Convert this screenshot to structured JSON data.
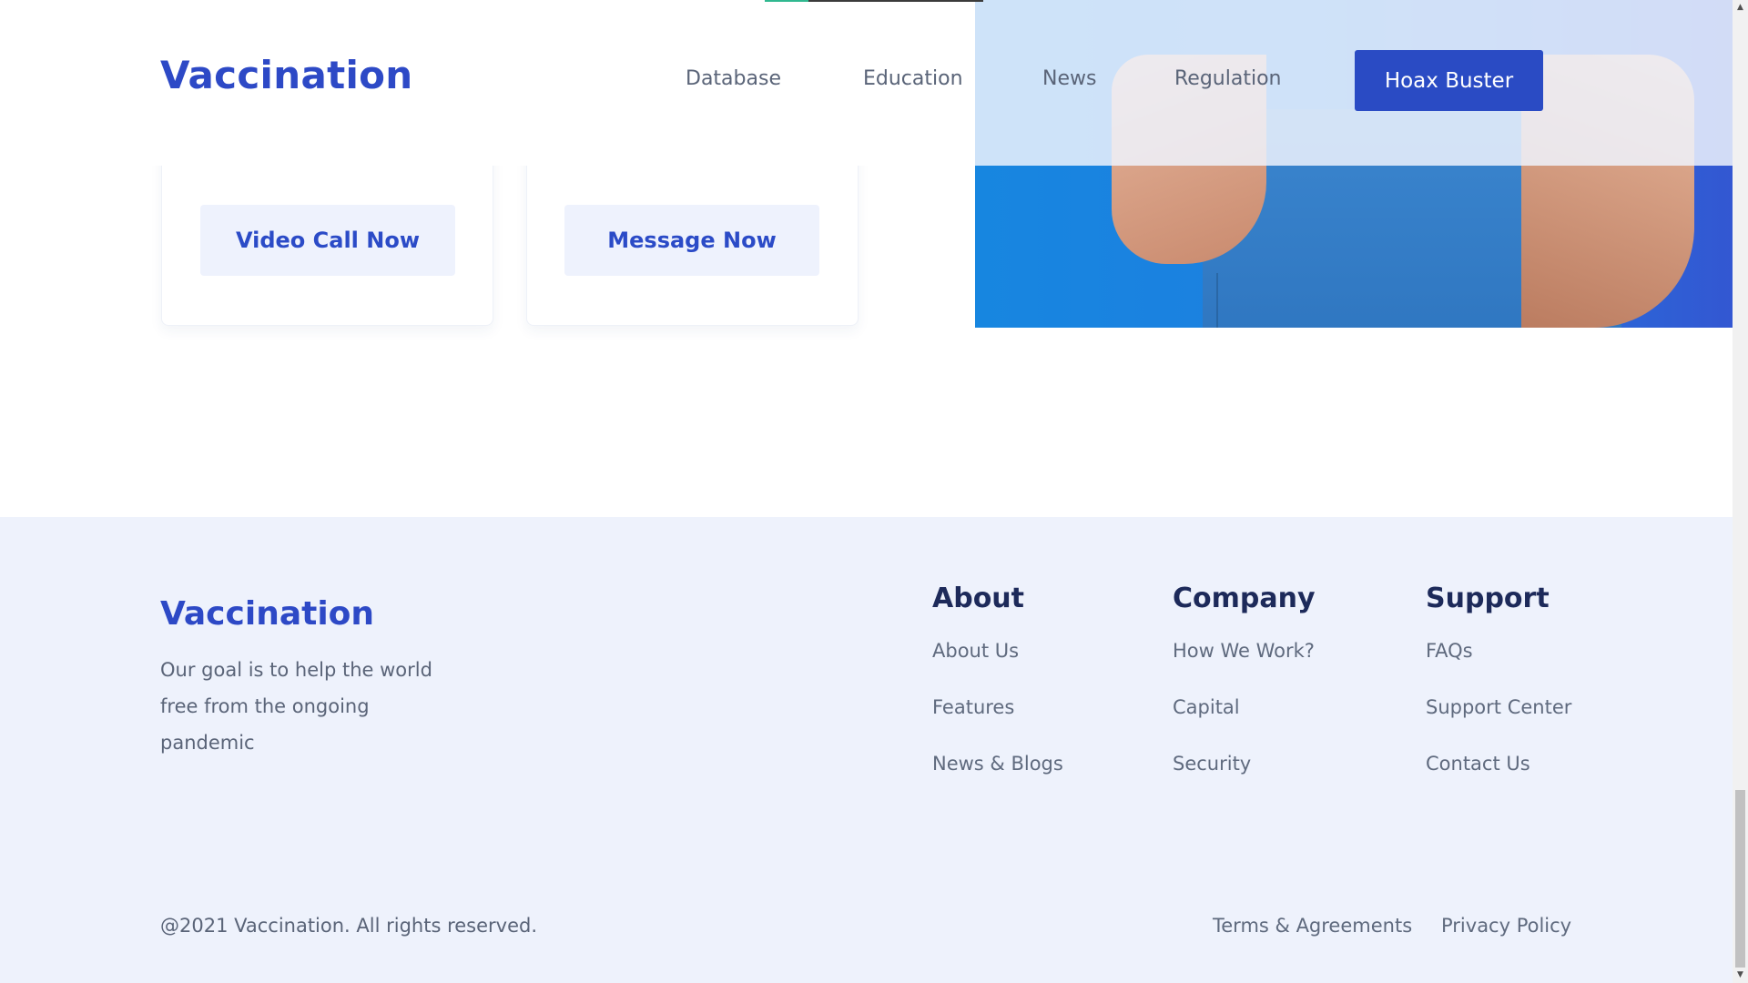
{
  "header": {
    "logo": "Vaccination",
    "nav": [
      "Database",
      "Education",
      "News",
      "Regulation"
    ],
    "cta": "Hoax Buster"
  },
  "consult": {
    "video_label": "Video Call Now",
    "message_label": "Message Now"
  },
  "footer": {
    "logo": "Vaccination",
    "tagline": "Our goal is to help the world free from the ongoing pandemic",
    "columns": [
      {
        "title": "About",
        "links": [
          "About Us",
          "Features",
          "News & Blogs"
        ]
      },
      {
        "title": "Company",
        "links": [
          "How We Work?",
          "Capital",
          "Security"
        ]
      },
      {
        "title": "Support",
        "links": [
          "FAQs",
          "Support Center",
          "Contact Us"
        ]
      }
    ],
    "copyright": "@2021 Vaccination. All rights reserved.",
    "legal": [
      "Terms & Agreements",
      "Privacy Policy"
    ]
  },
  "icons": {
    "scroll_up": "chevron-up-icon",
    "scroll_down": "chevron-down-icon"
  },
  "colors": {
    "brand": "#2d49c6",
    "primary_button": "#2a4bc4",
    "footer_bg": "#eef2fc",
    "hero_blue": "#1786e0"
  }
}
